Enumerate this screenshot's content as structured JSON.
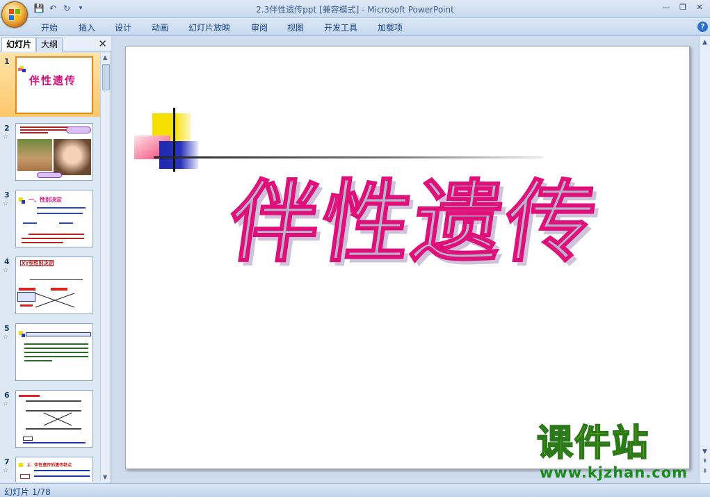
{
  "window": {
    "title": "2.3伴性遗传ppt [兼容模式]",
    "separator": " - ",
    "app_name": "Microsoft PowerPoint"
  },
  "ribbon": {
    "tabs": [
      "开始",
      "插入",
      "设计",
      "动画",
      "幻灯片放映",
      "审阅",
      "视图",
      "开发工具",
      "加载项"
    ]
  },
  "left_pane": {
    "tab_slides": "幻灯片",
    "tab_outline": "大纲",
    "slides": [
      {
        "num": "1",
        "title": "伴性遗传"
      },
      {
        "num": "2",
        "title": ""
      },
      {
        "num": "3",
        "title": "一、性别决定"
      },
      {
        "num": "4",
        "title": "XY型性别决定"
      },
      {
        "num": "5",
        "title": ""
      },
      {
        "num": "6",
        "title": ""
      },
      {
        "num": "7",
        "title": "2、伴性遗传的遗传特点"
      }
    ]
  },
  "slide": {
    "title": "伴性遗传"
  },
  "watermark": {
    "cn": "课件站",
    "url": "www.kjzhan.com"
  },
  "status": {
    "slide_info": "幻灯片 1/78"
  },
  "colors": {
    "title_fill": "#b7b4cd",
    "title_stroke": "#e0107a",
    "accent_yellow": "#f5df00",
    "accent_blue": "#2b33b8",
    "accent_pink": "#f06080"
  }
}
